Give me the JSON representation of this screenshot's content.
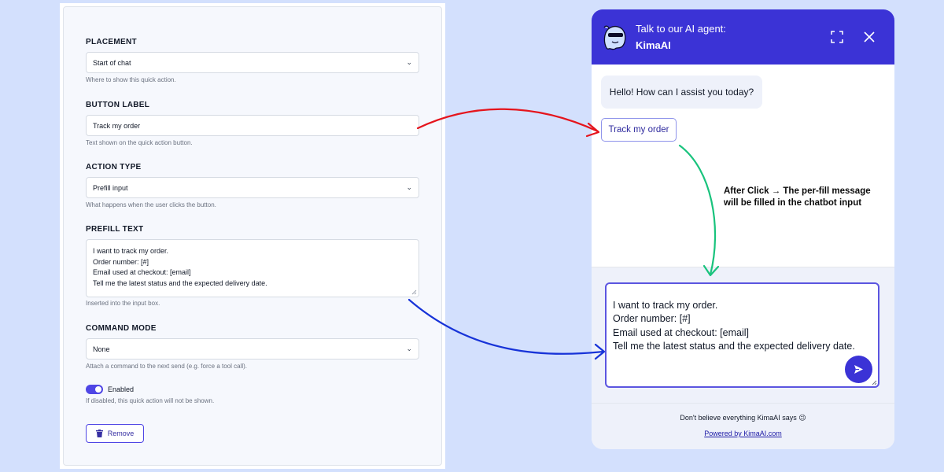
{
  "settings": {
    "placement": {
      "label": "PLACEMENT",
      "value": "Start of chat",
      "hint": "Where to show this quick action."
    },
    "button_label": {
      "label": "BUTTON LABEL",
      "value": "Track my order",
      "hint": "Text shown on the quick action button."
    },
    "action_type": {
      "label": "ACTION TYPE",
      "value": "Prefill input",
      "hint": "What happens when the user clicks the button."
    },
    "prefill_text": {
      "label": "PREFILL TEXT",
      "lines": [
        "I want to track my order.",
        "Order number: [#]",
        "Email used at checkout: [email]",
        "Tell me the latest status and the expected delivery date."
      ],
      "hint": "Inserted into the input box."
    },
    "command_mode": {
      "label": "COMMAND MODE",
      "value": "None",
      "hint": "Attach a command to the next send (e.g. force a tool call)."
    },
    "enabled": {
      "label": "Enabled",
      "on": true,
      "hint": "If disabled, this quick action will not be shown."
    },
    "remove_label": "Remove"
  },
  "chat": {
    "header_subtitle": "Talk to our AI agent:",
    "agent_name": "KimaAI",
    "greeting": "Hello! How can I assist you today?",
    "quick_action_label": "Track my order",
    "input_lines": [
      "I want to track my order.",
      "Order number: [#]",
      "Email used at checkout: [email]",
      "Tell me the latest status and the expected delivery date."
    ],
    "disclaimer": "Don't believe everything KimaAI says 😉",
    "powered_by": "Powered by KimaAI.com"
  },
  "annotation": {
    "lines": [
      "After Click → The per-fill message",
      "will be filled in the chatbot input"
    ]
  },
  "colors": {
    "background": "#d3e0fd",
    "brand": "#3b33d6",
    "toggle_on": "#4f46e5",
    "arrow_red": "#e5141c",
    "arrow_green": "#19c37d",
    "arrow_blue": "#1733d8"
  },
  "icons": {
    "chevron": "chevron-down-icon",
    "avatar": "ghost-avatar-icon",
    "expand": "expand-icon",
    "close": "close-icon",
    "send": "send-icon",
    "trash": "trash-icon"
  }
}
